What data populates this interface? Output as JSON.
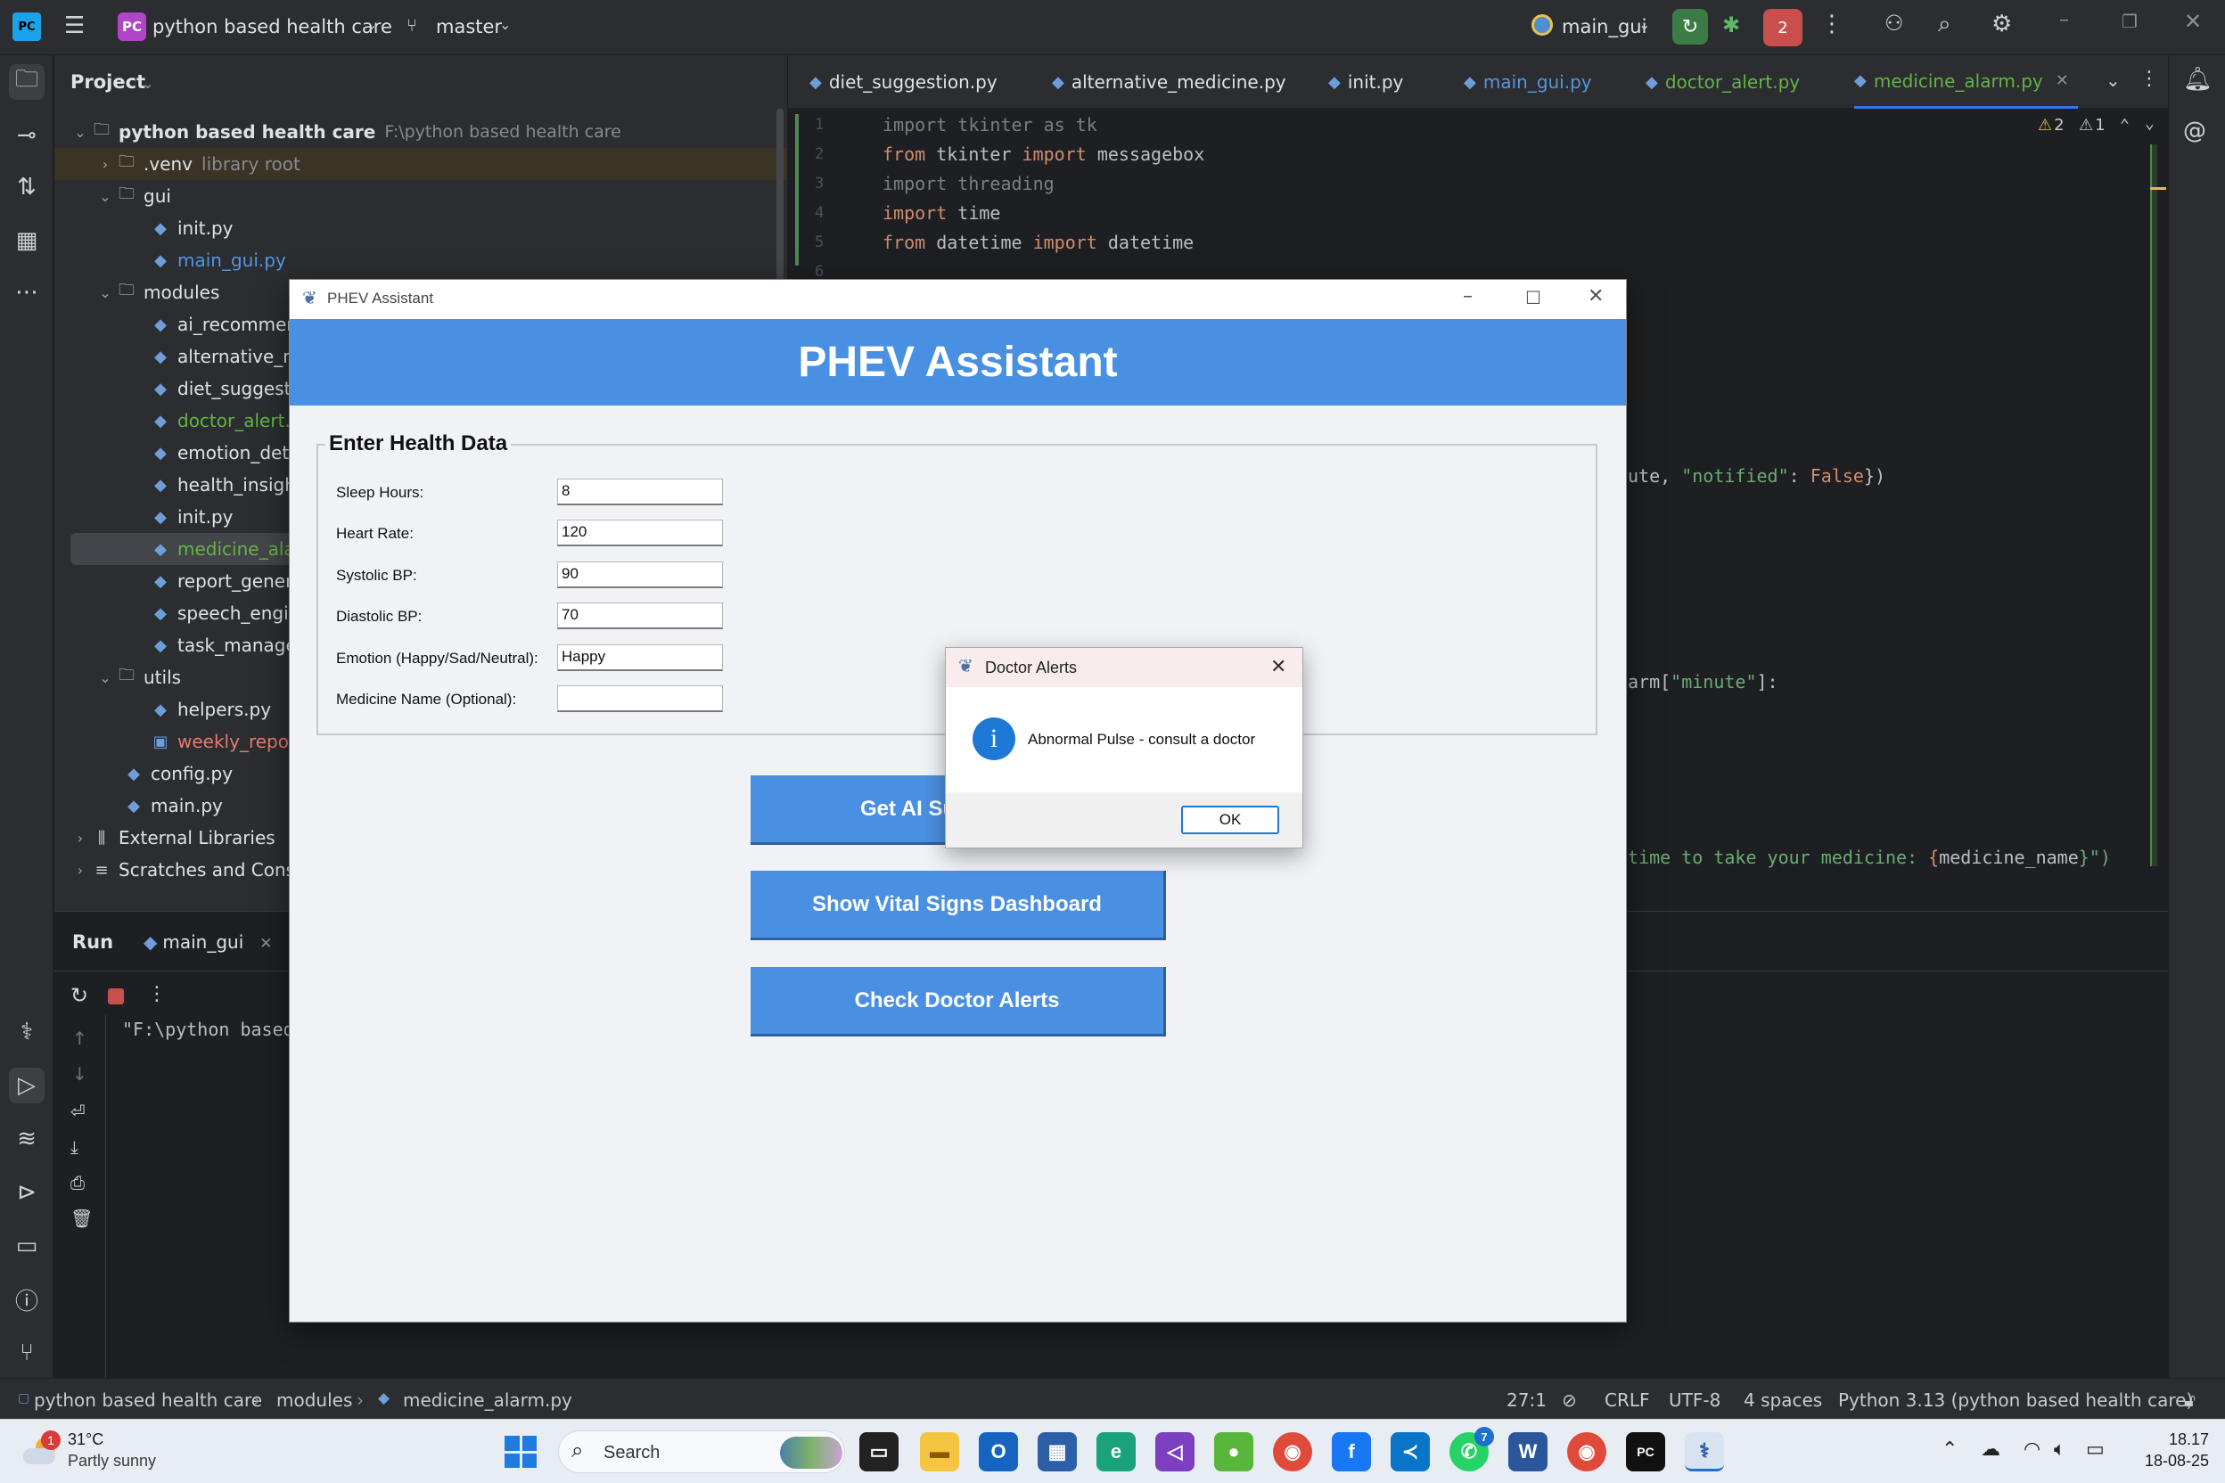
{
  "topbar": {
    "project_badge": "PC",
    "project_name": "python based health care",
    "branch": "master",
    "run_config": "main_gui",
    "stop_badge": "2"
  },
  "project_panel": {
    "title": "Project",
    "root_name": "python based health care",
    "root_path": "F:\\python based health care",
    "items": [
      {
        "label": "python based health care",
        "extra": "F:\\python based health care"
      },
      {
        "label": ".venv",
        "extra": "library root"
      },
      {
        "label": "gui",
        "extra": ""
      },
      {
        "label": "init.py",
        "extra": ""
      },
      {
        "label": "main_gui.py",
        "extra": ""
      },
      {
        "label": "modules",
        "extra": ""
      },
      {
        "label": "ai_recommend",
        "extra": ""
      },
      {
        "label": "alternative_m",
        "extra": ""
      },
      {
        "label": "diet_suggestic",
        "extra": ""
      },
      {
        "label": "doctor_alert.p",
        "extra": ""
      },
      {
        "label": "emotion_dete",
        "extra": ""
      },
      {
        "label": "health_insight",
        "extra": ""
      },
      {
        "label": "init.py",
        "extra": ""
      },
      {
        "label": "medicine_alar",
        "extra": ""
      },
      {
        "label": "report_genera",
        "extra": ""
      },
      {
        "label": "speech_engin",
        "extra": ""
      },
      {
        "label": "task_manager",
        "extra": ""
      },
      {
        "label": "utils",
        "extra": ""
      },
      {
        "label": "helpers.py",
        "extra": ""
      },
      {
        "label": "weekly_report",
        "extra": ""
      },
      {
        "label": "config.py",
        "extra": ""
      },
      {
        "label": "main.py",
        "extra": ""
      },
      {
        "label": "External Libraries",
        "extra": ""
      },
      {
        "label": "Scratches and Cons",
        "extra": ""
      }
    ]
  },
  "editor_tabs": [
    {
      "label": "diet_suggestion.py"
    },
    {
      "label": "alternative_medicine.py"
    },
    {
      "label": "init.py"
    },
    {
      "label": "main_gui.py"
    },
    {
      "label": "doctor_alert.py"
    },
    {
      "label": "medicine_alarm.py"
    }
  ],
  "editor": {
    "warnings": "2",
    "weak_warnings": "1",
    "line_numbers": [
      "1",
      "2",
      "3",
      "4",
      "5",
      "6"
    ],
    "lines": [
      {
        "a": "import",
        "b": " tkinter ",
        "c": "as",
        "d": " tk"
      },
      {
        "a": "from",
        "b": " tkinter ",
        "c": "import",
        "d": " messagebox"
      },
      {
        "a": "import",
        "b": " threading",
        "c": "",
        "d": ""
      },
      {
        "a": "import",
        "b": " time",
        "c": "",
        "d": ""
      },
      {
        "a": "from",
        "b": " datetime ",
        "c": "import",
        "d": " datetime"
      }
    ],
    "partial_1": {
      "a": "ute, ",
      "b": "\"notified\"",
      "c": ": ",
      "d": "False",
      "e": "})"
    },
    "partial_2": {
      "a": "arm[",
      "b": "\"minute\"",
      "c": "]:"
    },
    "partial_3": {
      "a": "time to take your medicine: ",
      "b": "{",
      "c": "medicine_name",
      "d": "}\")"
    }
  },
  "run_panel": {
    "title": "Run",
    "tab_label": "main_gui",
    "console_line": "\"F:\\python based"
  },
  "statusbar": {
    "crumb1": "python based health care",
    "crumb2": "modules",
    "crumb3": "medicine_alarm.py",
    "position": "27:1",
    "line_sep": "CRLF",
    "encoding": "UTF-8",
    "indent": "4 spaces",
    "interpreter": "Python 3.13 (python based health care)"
  },
  "phev": {
    "window_title": "PHEV Assistant",
    "header": "PHEV Assistant",
    "group_title": "Enter Health Data",
    "fields": [
      {
        "label": "Sleep Hours:",
        "value": "8"
      },
      {
        "label": "Heart Rate:",
        "value": "120"
      },
      {
        "label": "Systolic BP:",
        "value": "90"
      },
      {
        "label": "Diastolic BP:",
        "value": "70"
      },
      {
        "label": "Emotion (Happy/Sad/Neutral):",
        "value": "Happy"
      },
      {
        "label": "Medicine Name (Optional):",
        "value": ""
      }
    ],
    "buttons": {
      "ai": "Get AI Su",
      "vitals": "Show Vital Signs Dashboard",
      "alerts": "Check Doctor Alerts"
    }
  },
  "dialog": {
    "title": "Doctor Alerts",
    "message": "Abnormal Pulse - consult a doctor",
    "ok": "OK"
  },
  "taskbar": {
    "weather_temp": "31°C",
    "weather_desc": "Partly sunny",
    "weather_badge": "1",
    "search": "Search",
    "whatsapp_badge": "7",
    "time": "18.17",
    "date": "18-08-25"
  },
  "colors": {
    "accent": "#4a90e2",
    "ide_bg": "#1e1f22",
    "ide_panel": "#2b2d30",
    "vcs_added": "#62b543",
    "vcs_modified": "#5495e3"
  }
}
